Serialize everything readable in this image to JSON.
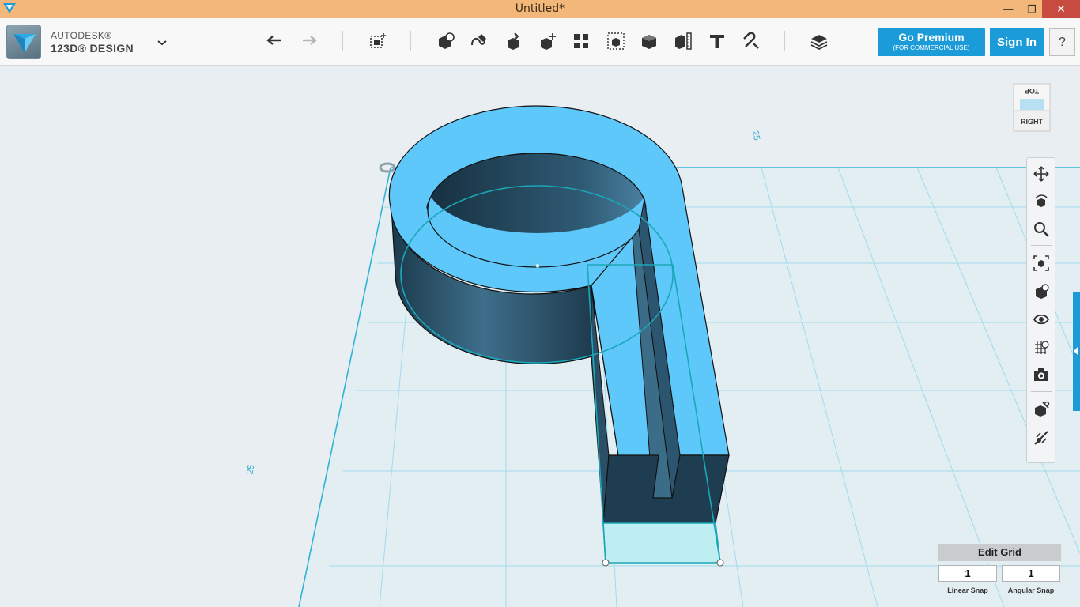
{
  "window": {
    "title": "Untitled*",
    "close_glyph": "✕",
    "maximize_glyph": "❐",
    "minimize_glyph": "—"
  },
  "brand": {
    "line1": "AUTODESK®",
    "line2": "123D® DESIGN"
  },
  "toolbar": {
    "icons": [
      "undo-icon",
      "redo-icon",
      "transform-icon",
      "primitives-icon",
      "sketch-icon",
      "construct-icon",
      "modify-icon",
      "pattern-icon",
      "grouping-icon",
      "combine-icon",
      "measure-icon",
      "text-icon",
      "snap-icon",
      "material-icon"
    ]
  },
  "premium": {
    "label": "Go Premium",
    "sublabel": "(FOR COMMERCIAL USE)"
  },
  "signin": {
    "label": "Sign In"
  },
  "help": {
    "label": "?"
  },
  "viewcube": {
    "top": "TOP",
    "right": "RIGHT"
  },
  "grid": {
    "label_left": "25",
    "label_top": "25"
  },
  "edit_grid": {
    "title": "Edit Grid",
    "linear_value": "1",
    "angular_value": "1",
    "linear_label": "Linear Snap",
    "angular_label": "Angular Snap"
  },
  "colors": {
    "accent": "#1c9bd9",
    "titlebar": "#f3b77a",
    "model_top": "#5ec8fb",
    "model_side": "#2a4f66",
    "grid_line": "#7fd0e6"
  }
}
